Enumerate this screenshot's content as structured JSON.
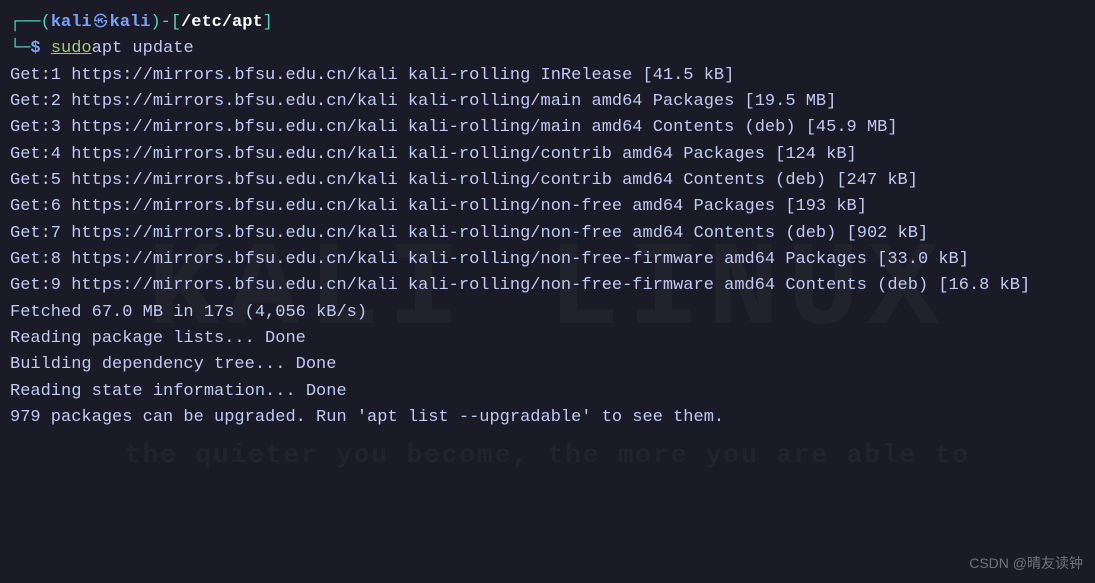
{
  "prompt": {
    "box_top": "┌──",
    "paren_open": "(",
    "user": "kali",
    "skull": "㉿",
    "host": "kali",
    "paren_close": ")",
    "dash": "-",
    "bracket_open": "[",
    "cwd": "/etc/apt",
    "bracket_close": "]",
    "box_bottom": "└─",
    "symbol": "$",
    "sudo": "sudo",
    "cmd": " apt update"
  },
  "output": {
    "lines": [
      "Get:1 https://mirrors.bfsu.edu.cn/kali kali-rolling InRelease [41.5 kB]",
      "Get:2 https://mirrors.bfsu.edu.cn/kali kali-rolling/main amd64 Packages [19.5 MB]",
      "Get:3 https://mirrors.bfsu.edu.cn/kali kali-rolling/main amd64 Contents (deb) [45.9 MB]",
      "Get:4 https://mirrors.bfsu.edu.cn/kali kali-rolling/contrib amd64 Packages [124 kB]",
      "Get:5 https://mirrors.bfsu.edu.cn/kali kali-rolling/contrib amd64 Contents (deb) [247 kB]",
      "Get:6 https://mirrors.bfsu.edu.cn/kali kali-rolling/non-free amd64 Packages [193 kB]",
      "Get:7 https://mirrors.bfsu.edu.cn/kali kali-rolling/non-free amd64 Contents (deb) [902 kB]",
      "Get:8 https://mirrors.bfsu.edu.cn/kali kali-rolling/non-free-firmware amd64 Packages [33.0 kB]",
      "Get:9 https://mirrors.bfsu.edu.cn/kali kali-rolling/non-free-firmware amd64 Contents (deb) [16.8 kB]",
      "Fetched 67.0 MB in 17s (4,056 kB/s)",
      "Reading package lists... Done",
      "Building dependency tree... Done",
      "Reading state information... Done",
      "979 packages can be upgraded. Run 'apt list --upgradable' to see them."
    ]
  },
  "watermark": "CSDN @晴友读钟",
  "bg": {
    "logo": "KALI LINUX",
    "tagline": "the quieter you become, the more you are able to"
  }
}
